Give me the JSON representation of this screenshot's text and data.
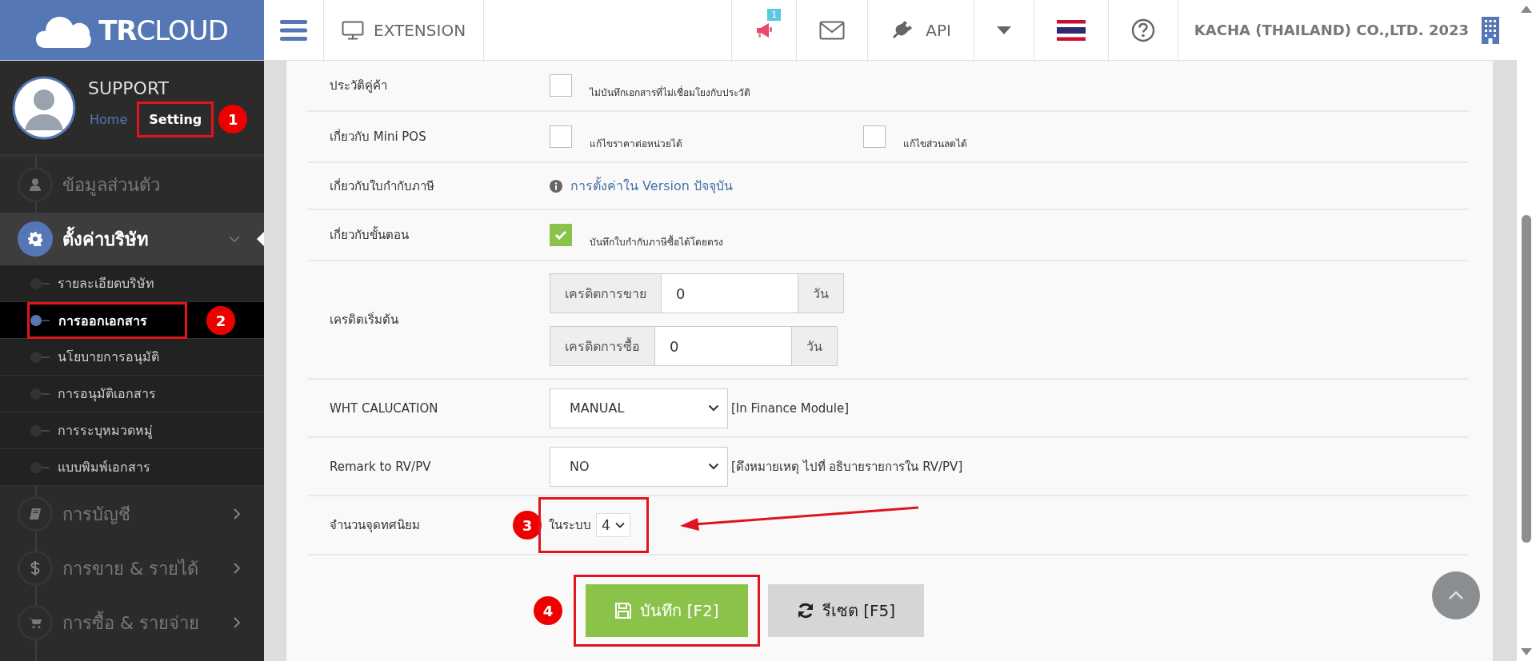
{
  "logo": {
    "bold": "TR",
    "text": "CLOUD"
  },
  "topbar": {
    "extension": "EXTENSION",
    "notification_count": "1",
    "api": "API",
    "company": "KACHA (THAILAND) CO.,LTD. 2023"
  },
  "user": {
    "name": "SUPPORT",
    "links": [
      {
        "label": "Home",
        "selected": false
      },
      {
        "label": "Setting",
        "selected": true,
        "step": "1"
      }
    ]
  },
  "menu": [
    {
      "label": "ข้อมูลส่วนตัว",
      "selected": false
    },
    {
      "label": "ตั้งค่าบริษัท",
      "selected": true,
      "expanded": true,
      "children": [
        {
          "label": "รายละเอียดบริษัท",
          "selected": false
        },
        {
          "label": "การออกเอกสาร",
          "selected": true,
          "step": "2"
        },
        {
          "label": "นโยบายการอนุมัติ",
          "selected": false
        },
        {
          "label": "การอนุมัติเอกสาร",
          "selected": false
        },
        {
          "label": "การระบุหมวดหมู่",
          "selected": false
        },
        {
          "label": "แบบพิมพ์เอกสาร",
          "selected": false
        }
      ]
    },
    {
      "label": "การบัญชี",
      "selected": false,
      "expanded": false
    },
    {
      "label": "การขาย & รายได้",
      "selected": false,
      "expanded": false
    },
    {
      "label": "การซื้อ & รายจ่าย",
      "selected": false,
      "expanded": false
    }
  ],
  "form_rows": [
    {
      "kind": "checkboxes",
      "label": "ประวัติคู่ค้า",
      "options": [
        {
          "label": "ไม่บันทึกเอกสารที่ไม่เชื่อมโยงกับประวัติ",
          "checked": false
        }
      ]
    },
    {
      "kind": "checkboxes",
      "label": "เกี่ยวกับ Mini POS",
      "options": [
        {
          "label": "แก้ไขราคาต่อหน่วยได้",
          "checked": false
        },
        {
          "label": "แก้ไขส่วนลดได้",
          "checked": false
        }
      ]
    },
    {
      "kind": "link",
      "label": "เกี่ยวกับใบกำกับภาษี",
      "link": "การตั้งค่าใน Version ปัจจุบัน"
    },
    {
      "kind": "checkboxes",
      "label": "เกี่ยวกับขั้นตอน",
      "options": [
        {
          "label": "บันทึกใบกำกับภาษีซื้อได้โดยตรง",
          "checked": true
        }
      ]
    },
    {
      "kind": "credit",
      "label": "เครดิตเริ่มต้น",
      "groups": [
        {
          "prefix": "เครดิตการขาย",
          "value": "0",
          "suffix": "วัน"
        },
        {
          "prefix": "เครดิตการซื้อ",
          "value": "0",
          "suffix": "วัน"
        }
      ]
    },
    {
      "kind": "select",
      "label": "WHT CALUCATION",
      "value": "MANUAL",
      "note": "[In Finance Module]"
    },
    {
      "kind": "select",
      "label": "Remark to RV/PV",
      "value": "NO",
      "note": "[ดึงหมายเหตุ ไปที่ อธิบายรายการใน RV/PV]"
    },
    {
      "kind": "decimal",
      "label": "จำนวนจุดทศนิยม",
      "prefix": "ในระบบ",
      "value": "4",
      "step": "3",
      "arrow": true
    }
  ],
  "buttons": [
    {
      "kind": "save",
      "label": "บันทึก [F2]",
      "step": "4"
    },
    {
      "kind": "reset",
      "label": "รีเซต [F5]"
    }
  ]
}
